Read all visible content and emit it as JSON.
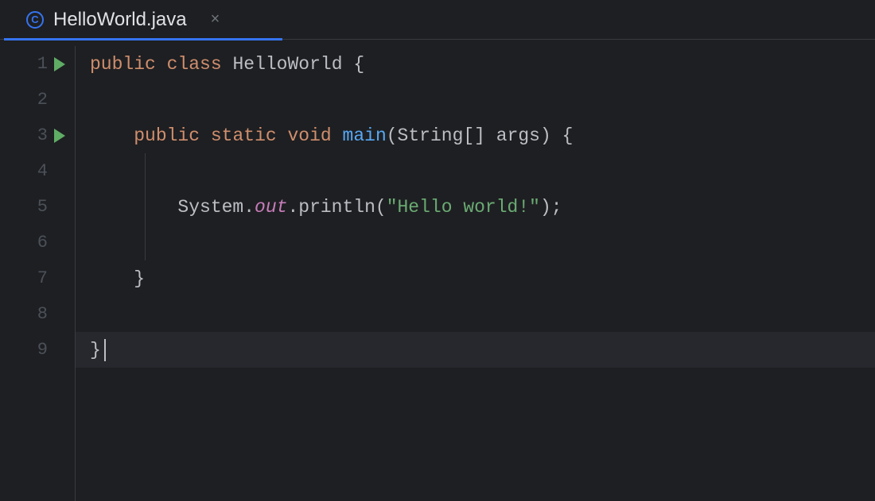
{
  "tab": {
    "filename": "HelloWorld.java",
    "file_icon_letter": "C"
  },
  "gutter": {
    "lines": [
      "1",
      "2",
      "3",
      "4",
      "5",
      "6",
      "7",
      "8",
      "9"
    ],
    "run_markers": [
      1,
      3
    ]
  },
  "code": {
    "line1": {
      "kw_public": "public",
      "kw_class": "class",
      "classname": "HelloWorld",
      "brace": "{"
    },
    "line3": {
      "kw_public": "public",
      "kw_static": "static",
      "kw_void": "void",
      "method": "main",
      "params": "(String[] args) {"
    },
    "line5": {
      "system": "System.",
      "out": "out",
      "println": ".println(",
      "string": "\"Hello world!\"",
      "end": ");"
    },
    "line7": {
      "brace": "}"
    },
    "line9": {
      "brace": "}"
    }
  },
  "colors": {
    "keyword": "#cf8e6d",
    "method": "#56a8f5",
    "field": "#c77dbb",
    "string": "#6aab73",
    "accent": "#3574f0",
    "run": "#5fad65"
  }
}
